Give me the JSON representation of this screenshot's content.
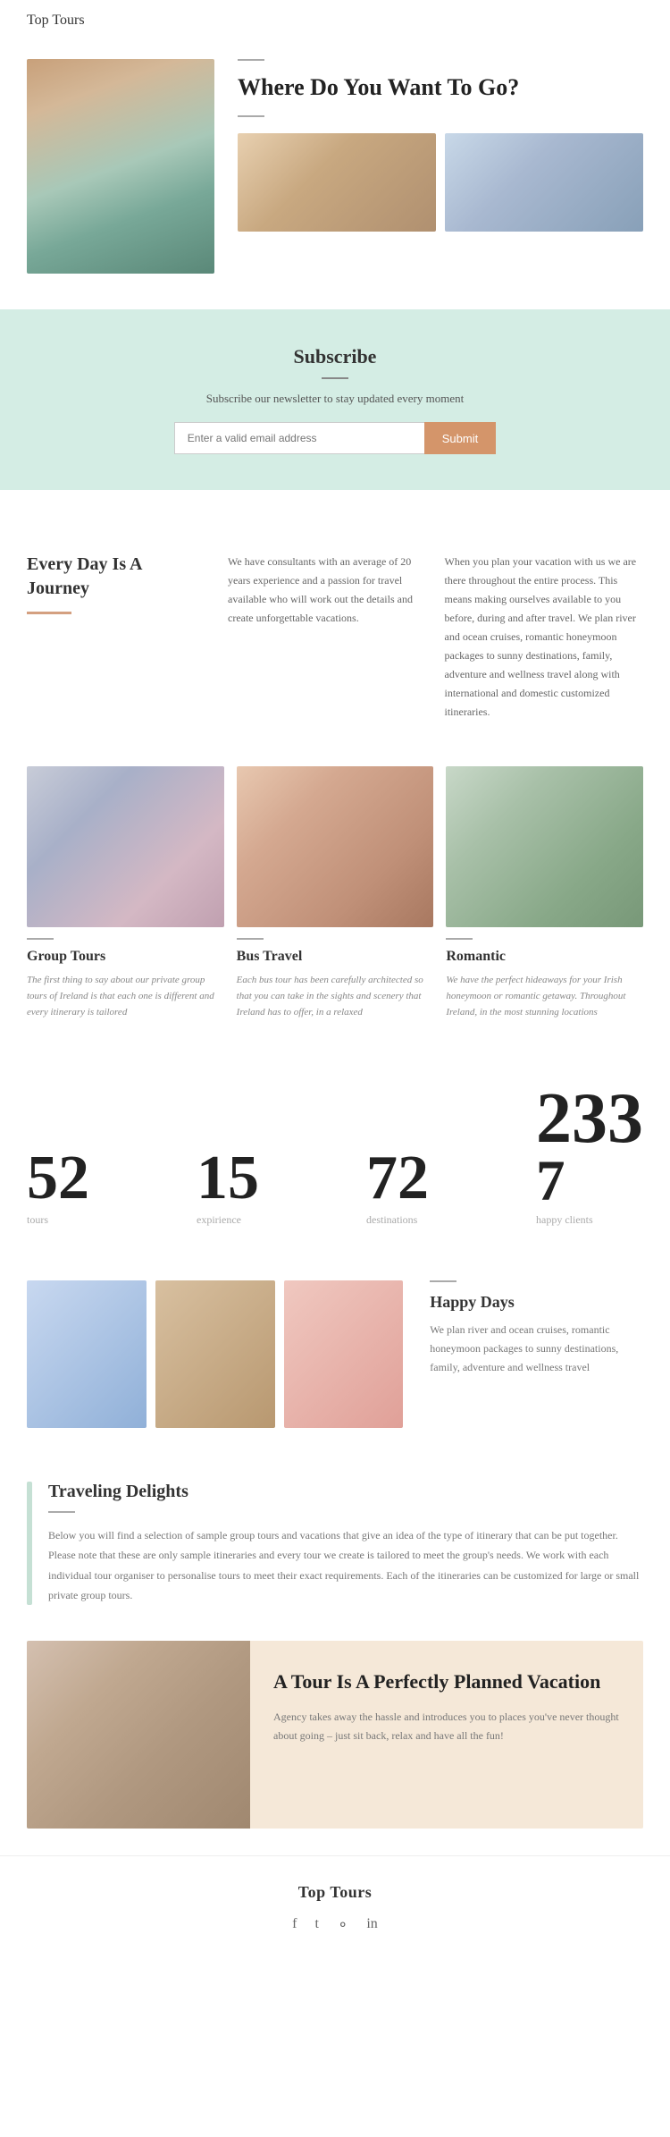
{
  "nav": {
    "logo": "Top Tours"
  },
  "hero": {
    "divider": "",
    "title": "Where Do You Want To Go?",
    "divider2": ""
  },
  "subscribe": {
    "title": "Subscribe",
    "text": "Subscribe our newsletter to stay updated every moment",
    "input_placeholder": "Enter a valid email address",
    "button": "Submit"
  },
  "journey": {
    "title": "Every Day Is A Journey",
    "col1": "We have consultants with an average of 20 years experience and a passion for travel available who will work out the details and create unforgettable vacations.",
    "col2": "When you plan your vacation with us we are there throughout the entire process. This means making ourselves available to you before, during and after travel.\n\nWe plan river and ocean cruises, romantic honeymoon packages to sunny destinations, family, adventure and wellness travel along with international and domestic customized itineraries."
  },
  "tours": [
    {
      "name": "Group Tours",
      "desc": "The first thing to say about our private group tours of Ireland is that each one is different and every itinerary is tailored"
    },
    {
      "name": "Bus Travel",
      "desc": "Each bus tour has been carefully architected so that you can take in the sights and scenery that Ireland has to offer, in a relaxed"
    },
    {
      "name": "Romantic",
      "desc": "We have the perfect hideaways for your Irish honeymoon or romantic getaway. Throughout Ireland, in the most stunning locations"
    }
  ],
  "stats": [
    {
      "number": "52",
      "label": "tours"
    },
    {
      "number": "15",
      "label": "expirience"
    },
    {
      "number": "72",
      "label": "destinations"
    },
    {
      "number": "233",
      "sub": "7",
      "label": "happy clients"
    }
  ],
  "happy": {
    "title": "Happy Days",
    "text": "We plan river and ocean cruises, romantic honeymoon packages to sunny destinations, family, adventure and wellness travel"
  },
  "delights": {
    "title": "Traveling Delights",
    "text": "Below you will find a selection of sample group tours and vacations that give an idea of the type of itinerary that can be put together. Please note that these are only sample itineraries and every tour we create is tailored to meet the group's needs. We work with each individual tour organiser to personalise tours to meet their exact requirements. Each of the itineraries can be customized for large or small private group tours."
  },
  "vacation": {
    "title": "A Tour Is A Perfectly Planned Vacation",
    "text": "Agency takes away the hassle and introduces you to places you've never thought about going – just sit back, relax and have all the fun!"
  },
  "footer": {
    "logo": "Top Tours",
    "icons": [
      "f",
      "t",
      "in-icon",
      "in"
    ]
  }
}
